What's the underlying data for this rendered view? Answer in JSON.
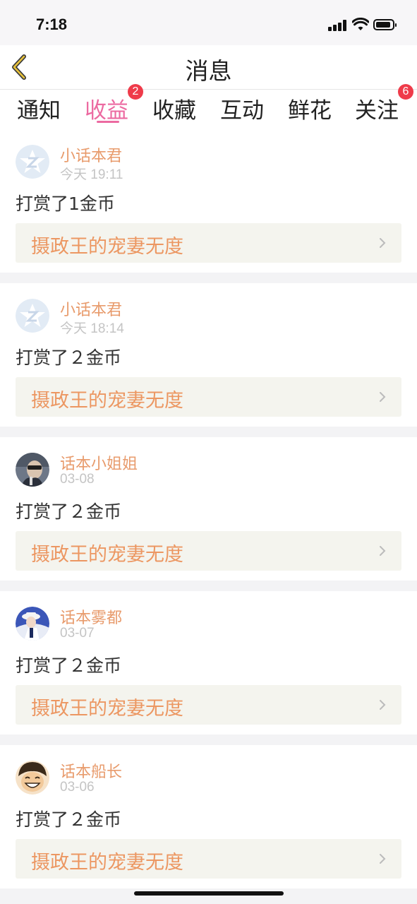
{
  "status": {
    "time": "7:18"
  },
  "nav": {
    "title": "消息",
    "back_icon": "chevron-left-icon"
  },
  "tabs": [
    {
      "label": "通知",
      "active": false,
      "badge": ""
    },
    {
      "label": "收益",
      "active": true,
      "badge": "2"
    },
    {
      "label": "收藏",
      "active": false,
      "badge": ""
    },
    {
      "label": "互动",
      "active": false,
      "badge": ""
    },
    {
      "label": "鲜花",
      "active": false,
      "badge": ""
    },
    {
      "label": "关注",
      "active": false,
      "badge": "6"
    }
  ],
  "colors": {
    "accent": "#ec6aa1",
    "name": "#e89b6c",
    "book": "#ec9762",
    "badge": "#ef3b4a"
  },
  "messages": [
    {
      "user": "小话本君",
      "date": "今天 19:11",
      "action": "打赏了1金币",
      "book": "摄政王的宠妻无度",
      "avatar": "app-logo-avatar"
    },
    {
      "user": "小话本君",
      "date": "今天 18:14",
      "action": "打赏了２金币",
      "book": "摄政王的宠妻无度",
      "avatar": "app-logo-avatar"
    },
    {
      "user": "话本小姐姐",
      "date": "03-08",
      "action": "打赏了２金币",
      "book": "摄政王的宠妻无度",
      "avatar": "user-photo-avatar"
    },
    {
      "user": "话本雾都",
      "date": "03-07",
      "action": "打赏了２金币",
      "book": "摄政王的宠妻无度",
      "avatar": "user-photo-avatar"
    },
    {
      "user": "话本船长",
      "date": "03-06",
      "action": "打赏了２金币",
      "book": "摄政王的宠妻无度",
      "avatar": "cartoon-avatar"
    }
  ]
}
